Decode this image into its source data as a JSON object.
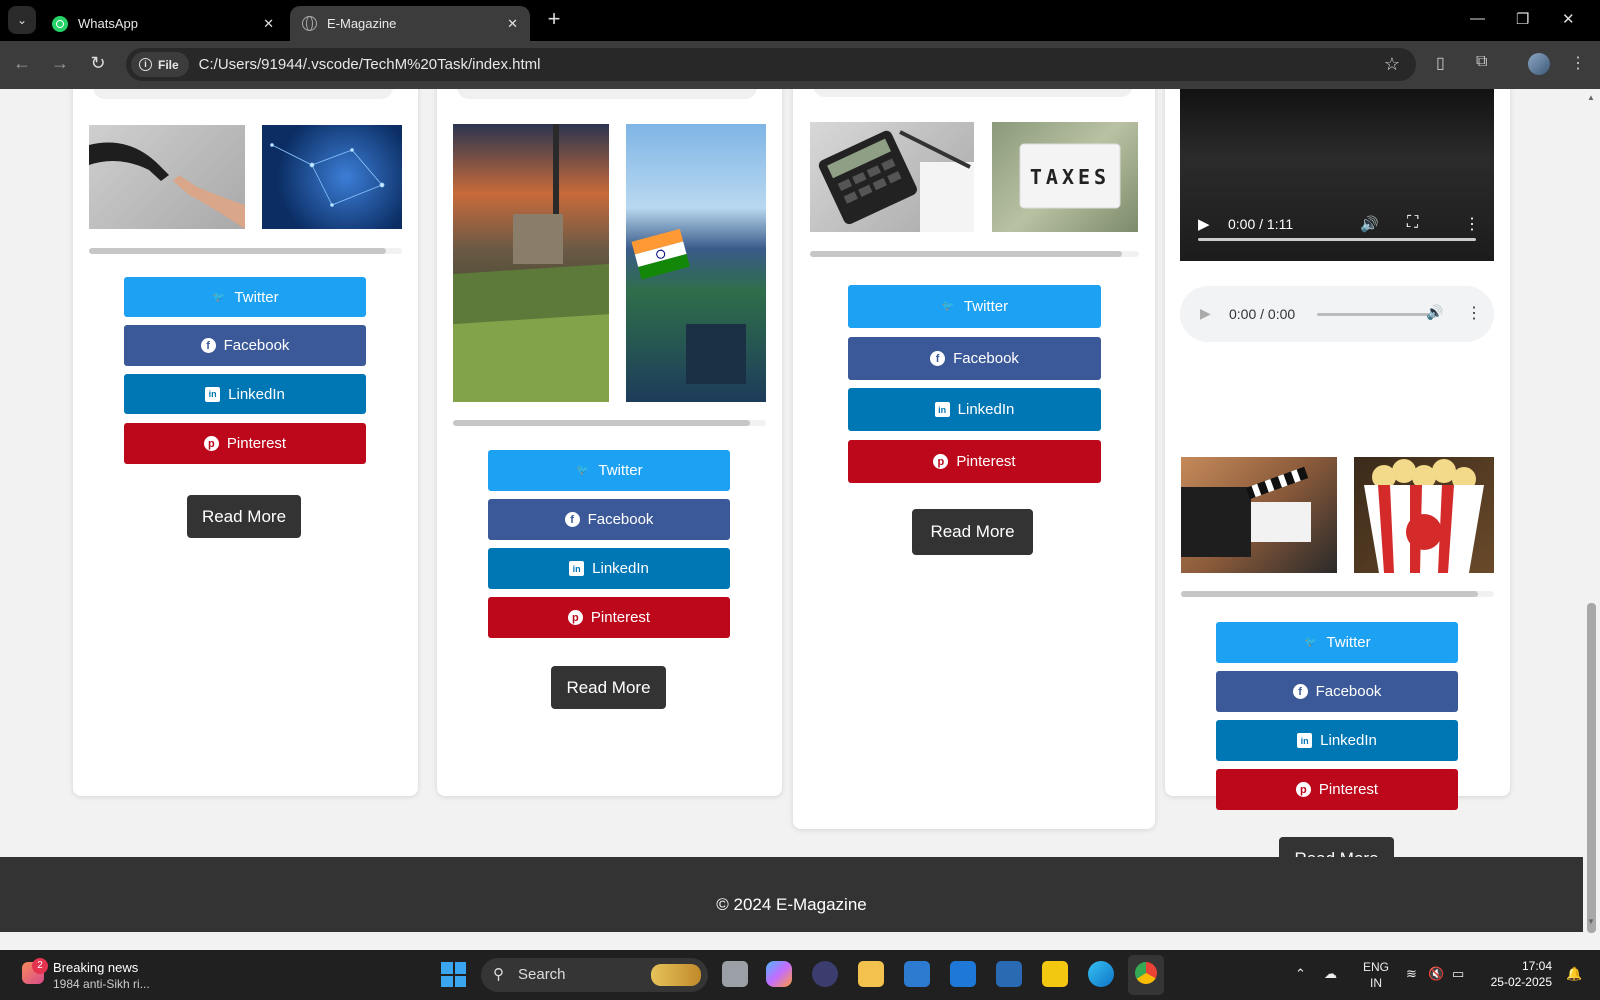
{
  "browser": {
    "tabs": [
      {
        "title": "WhatsApp",
        "icon": "whatsapp-icon",
        "active": false
      },
      {
        "title": "E-Magazine",
        "icon": "globe-icon",
        "active": true
      }
    ],
    "address_chip": "File",
    "url": "C:/Users/91944/.vscode/TechM%20Task/index.html"
  },
  "share_labels": {
    "twitter": "Twitter",
    "facebook": "Facebook",
    "linkedin": "LinkedIn",
    "pinterest": "Pinterest"
  },
  "read_more": "Read More",
  "colors": {
    "twitter": "#1da1f2",
    "facebook": "#3b5998",
    "linkedin": "#0077b5",
    "pinterest": "#bd081c",
    "footer": "#333333"
  },
  "cards": [
    {
      "images": [
        "robot-hand-touch",
        "ai-brain-network"
      ]
    },
    {
      "images": [
        "cricket-stadium-sunset",
        "india-flag-stadium"
      ]
    },
    {
      "images": [
        "calculator-documents",
        "taxes-money"
      ]
    },
    {
      "images": [
        "film-clapperboard",
        "popcorn-box"
      ]
    }
  ],
  "media": {
    "video_time": "0:00 / 1:11",
    "audio_time": "0:00 / 0:00"
  },
  "footer": {
    "text": "© 2024 E-Magazine"
  },
  "taskbar": {
    "news_badge": "2",
    "news_title": "Breaking news",
    "news_subtitle": "1984 anti-Sikh ri...",
    "search_label": "Search",
    "lang_top": "ENG",
    "lang_bottom": "IN",
    "time": "17:04",
    "date": "25-02-2025"
  }
}
